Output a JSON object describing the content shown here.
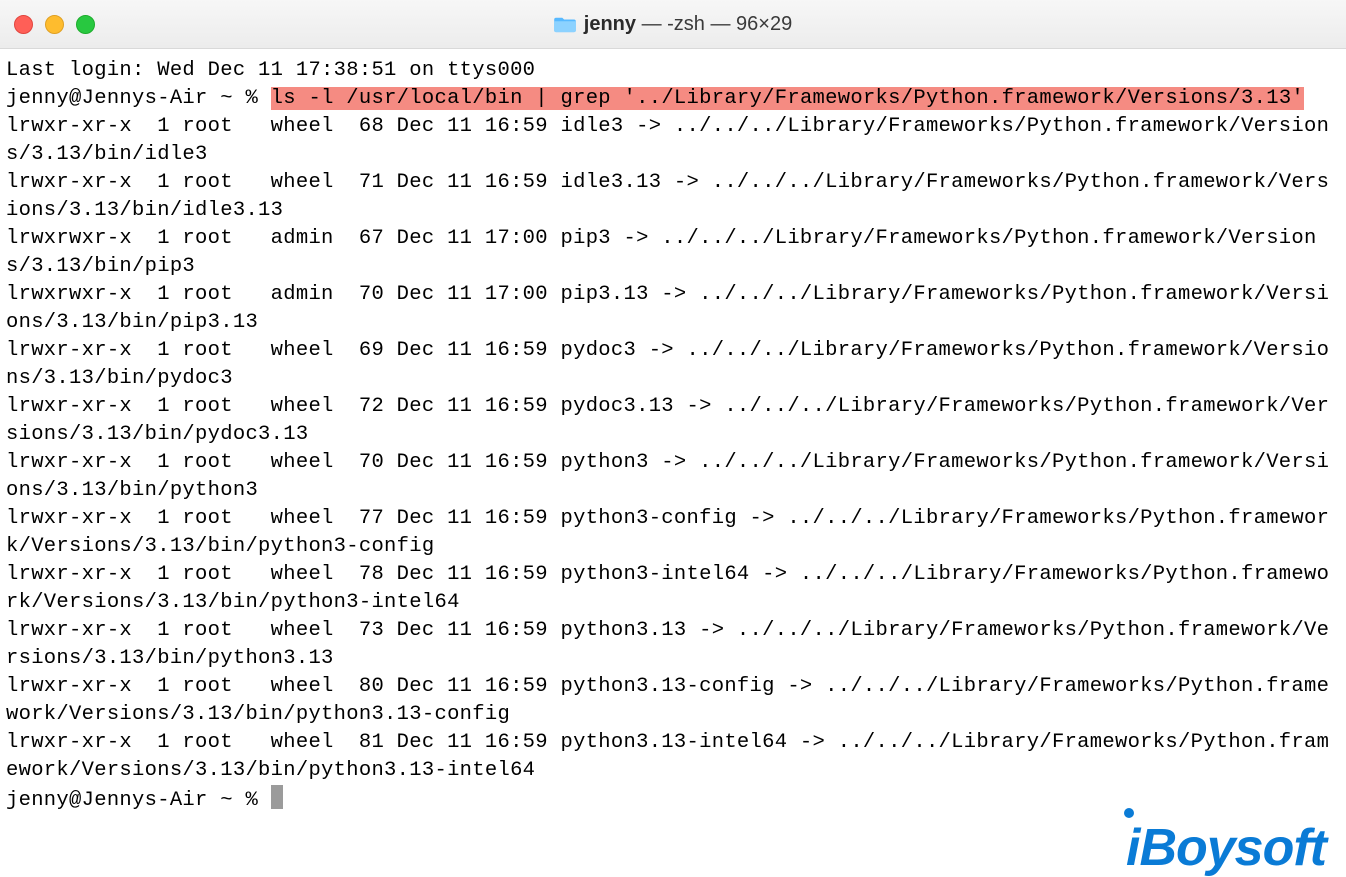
{
  "window": {
    "title_folder": "jenny",
    "title_rest": " — -zsh — 96×29"
  },
  "terminal": {
    "login_line": "Last login: Wed Dec 11 17:38:51 on ttys000",
    "prompt1_prefix": "jenny@Jennys-Air ~ % ",
    "command_hl": "ls -l /usr/local/bin | grep '../Library/Frameworks/Python.framework/Versions/3.13'",
    "lines": [
      "lrwxr-xr-x  1 root   wheel  68 Dec 11 16:59 idle3 -> ../../../Library/Frameworks/Python.framework/Versions/3.13/bin/idle3",
      "lrwxr-xr-x  1 root   wheel  71 Dec 11 16:59 idle3.13 -> ../../../Library/Frameworks/Python.framework/Versions/3.13/bin/idle3.13",
      "lrwxrwxr-x  1 root   admin  67 Dec 11 17:00 pip3 -> ../../../Library/Frameworks/Python.framework/Versions/3.13/bin/pip3",
      "lrwxrwxr-x  1 root   admin  70 Dec 11 17:00 pip3.13 -> ../../../Library/Frameworks/Python.framework/Versions/3.13/bin/pip3.13",
      "lrwxr-xr-x  1 root   wheel  69 Dec 11 16:59 pydoc3 -> ../../../Library/Frameworks/Python.framework/Versions/3.13/bin/pydoc3",
      "lrwxr-xr-x  1 root   wheel  72 Dec 11 16:59 pydoc3.13 -> ../../../Library/Frameworks/Python.framework/Versions/3.13/bin/pydoc3.13",
      "lrwxr-xr-x  1 root   wheel  70 Dec 11 16:59 python3 -> ../../../Library/Frameworks/Python.framework/Versions/3.13/bin/python3",
      "lrwxr-xr-x  1 root   wheel  77 Dec 11 16:59 python3-config -> ../../../Library/Frameworks/Python.framework/Versions/3.13/bin/python3-config",
      "lrwxr-xr-x  1 root   wheel  78 Dec 11 16:59 python3-intel64 -> ../../../Library/Frameworks/Python.framework/Versions/3.13/bin/python3-intel64",
      "lrwxr-xr-x  1 root   wheel  73 Dec 11 16:59 python3.13 -> ../../../Library/Frameworks/Python.framework/Versions/3.13/bin/python3.13",
      "lrwxr-xr-x  1 root   wheel  80 Dec 11 16:59 python3.13-config -> ../../../Library/Frameworks/Python.framework/Versions/3.13/bin/python3.13-config",
      "lrwxr-xr-x  1 root   wheel  81 Dec 11 16:59 python3.13-intel64 -> ../../../Library/Frameworks/Python.framework/Versions/3.13/bin/python3.13-intel64"
    ],
    "prompt2": "jenny@Jennys-Air ~ % "
  },
  "watermark": "iBoysoft"
}
